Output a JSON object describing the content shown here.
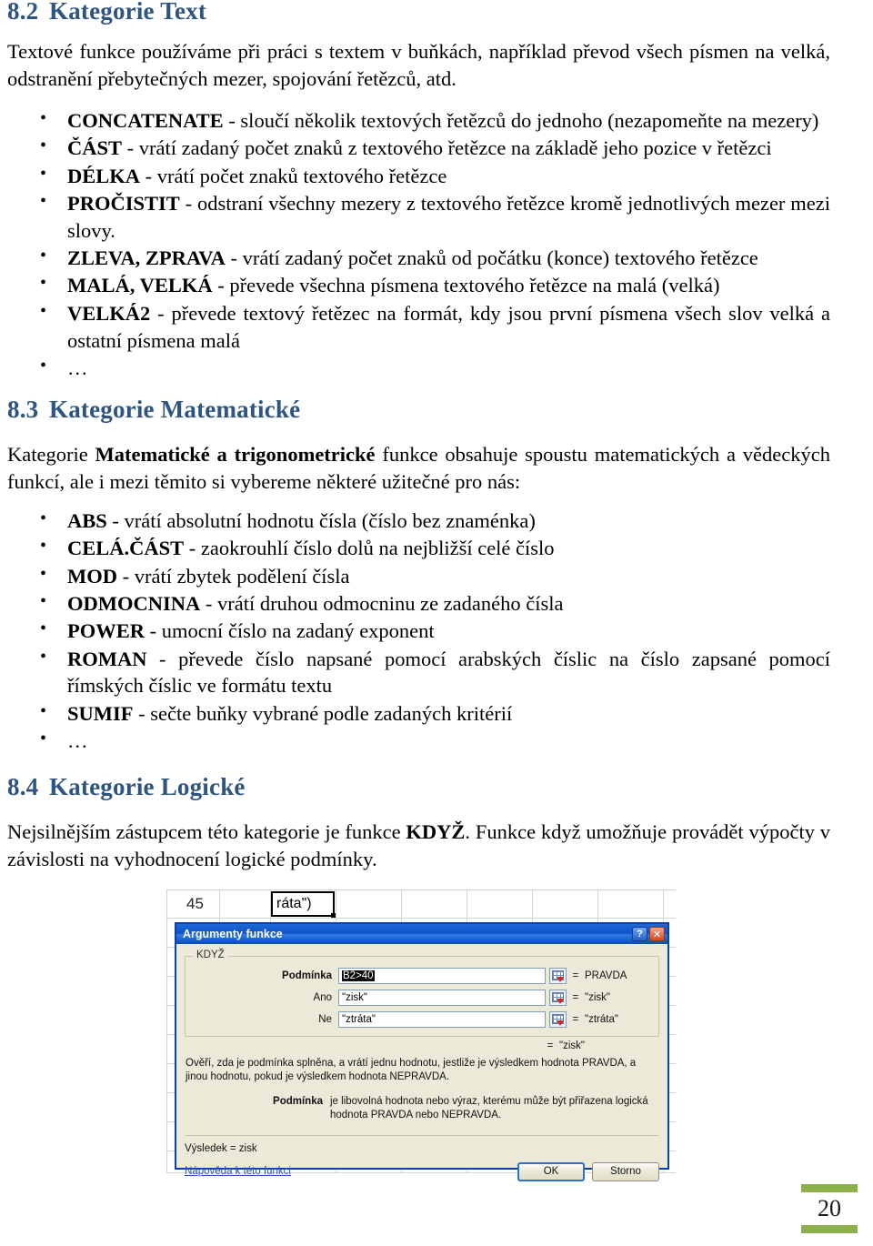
{
  "document": {
    "page_number": "20"
  },
  "sections": {
    "text_category": {
      "number": "8.2",
      "title": "Kategorie Text",
      "intro": "Textové funkce používáme při práci s textem v buňkách, například převod všech písmen na velká, odstranění přebytečných mezer, spojování řetězců, atd.",
      "items": [
        {
          "name": "CONCATENATE",
          "desc": " - sloučí několik textových řetězců do jednoho (nezapomeňte na mezery)"
        },
        {
          "name": "ČÁST",
          "desc": " - vrátí zadaný počet znaků z textového řetězce na základě jeho pozice v řetězci"
        },
        {
          "name": "DÉLKA",
          "desc": " - vrátí počet znaků textového řetězce"
        },
        {
          "name": "PROČISTIT",
          "desc": " - odstraní všechny mezery z textového řetězce kromě jednotlivých mezer mezi slovy."
        },
        {
          "name": "ZLEVA, ZPRAVA",
          "desc": " - vrátí zadaný počet znaků od počátku (konce) textového řetězce"
        },
        {
          "name": "MALÁ, VELKÁ",
          "desc": " - převede všechna písmena textového řetězce na malá (velká)"
        },
        {
          "name": "VELKÁ2",
          "desc": " - převede textový řetězec na formát, kdy jsou první písmena všech slov velká a ostatní písmena malá"
        },
        {
          "name": "",
          "desc": "…"
        }
      ]
    },
    "math_category": {
      "number": "8.3",
      "title": "Kategorie Matematické",
      "intro_before": "Kategorie ",
      "intro_bold": "Matematické a trigonometrické",
      "intro_after": " funkce obsahuje spoustu matematických a vědeckých funkcí, ale i mezi těmito si vybereme některé užitečné pro nás:",
      "items": [
        {
          "name": "ABS",
          "desc": " - vrátí absolutní hodnotu čísla (číslo bez znaménka)"
        },
        {
          "name": "CELÁ.ČÁST",
          "desc": " - zaokrouhlí číslo dolů na nejbližší celé číslo"
        },
        {
          "name": "MOD",
          "desc": " - vrátí zbytek podělení čísla"
        },
        {
          "name": "ODMOCNINA",
          "desc": " - vrátí druhou odmocninu ze zadaného čísla"
        },
        {
          "name": "POWER",
          "desc": " - umocní číslo na zadaný exponent"
        },
        {
          "name": "ROMAN",
          "desc": " - převede číslo napsané pomocí arabských číslic na číslo zapsané pomocí římských číslic ve formátu textu"
        },
        {
          "name": "SUMIF",
          "desc": " - sečte buňky vybrané podle zadaných kritérií"
        },
        {
          "name": "",
          "desc": "…"
        }
      ]
    },
    "logic_category": {
      "number": "8.4",
      "title": "Kategorie Logické",
      "intro_before": "Nejsilnějším zástupcem této kategorie je funkce ",
      "intro_bold": "KDYŽ",
      "intro_after": ". Funkce když umožňuje provádět výpočty v závislosti na vyhodnocení logické podmínky."
    }
  },
  "screenshot": {
    "spreadsheet": {
      "cell_value": "45",
      "active_cell_text": "ráta\")"
    },
    "dialog": {
      "title": "Argumenty funkce",
      "help_button": "?",
      "close_button": "✕",
      "group_label": "KDYŽ",
      "arguments": [
        {
          "label": "Podmínka",
          "value": "B2>40",
          "equals": "=",
          "result": "PRAVDA",
          "bold": true,
          "selected": true
        },
        {
          "label": "Ano",
          "value": "\"zisk\"",
          "equals": "=",
          "result": "\"zisk\"",
          "bold": false,
          "selected": false
        },
        {
          "label": "Ne",
          "value": "\"ztráta\"",
          "equals": "=",
          "result": "\"ztráta\"",
          "bold": false,
          "selected": false
        }
      ],
      "overall_equals": "=",
      "overall_value": "\"zisk\"",
      "description": "Ověří, zda je podmínka splněna, a vrátí jednu hodnotu, jestliže je výsledkem hodnota PRAVDA, a jinou hodnotu, pokud je výsledkem hodnota NEPRAVDA.",
      "arg_help_name": "Podmínka",
      "arg_help_text": "je libovolná hodnota nebo výraz, kterému může být přiřazena logická hodnota PRAVDA nebo NEPRAVDA.",
      "result_line": "Výsledek =   zisk",
      "help_link": "Nápověda k této funkci",
      "ok_button": "OK",
      "cancel_button": "Storno"
    }
  },
  "colors": {
    "heading": "#2e5580",
    "footer_bar": "#8cb04a",
    "titlebar": "#0f52c8",
    "dialog_face": "#ece9d8"
  }
}
